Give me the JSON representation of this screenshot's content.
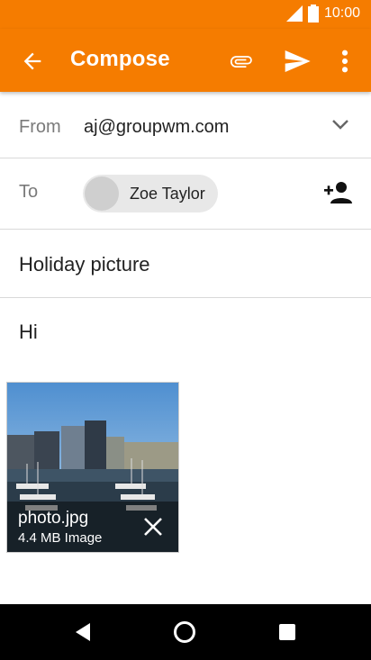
{
  "status_bar": {
    "time": "10:00"
  },
  "app_bar": {
    "title": "Compose",
    "back_icon": "arrow-back-icon",
    "attach_icon": "paperclip-icon",
    "send_icon": "send-icon",
    "more_icon": "more-vert-icon",
    "color": "#f57c00"
  },
  "from": {
    "label": "From",
    "value": "aj@groupwm.com"
  },
  "to": {
    "label": "To",
    "recipient": "Zoe Taylor"
  },
  "subject": "Holiday picture",
  "body": "Hi",
  "attachment": {
    "name": "photo.jpg",
    "meta": "4.4 MB Image"
  },
  "nav_bar": {
    "icons": [
      "back-icon",
      "home-icon",
      "recents-icon"
    ]
  }
}
